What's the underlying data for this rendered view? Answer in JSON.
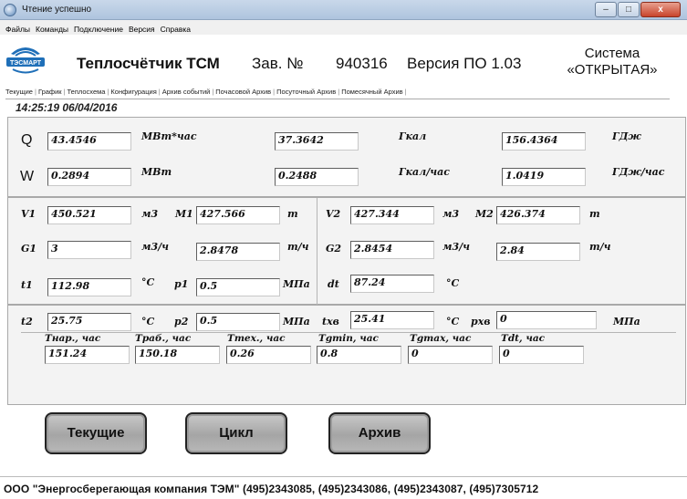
{
  "window": {
    "title": "Чтение успешно",
    "btn_min": "–",
    "btn_max": "□",
    "btn_close": "x"
  },
  "menu": [
    "Файлы",
    "Команды",
    "Подключение",
    "Версия",
    "Справка"
  ],
  "logo_text": "ТЭСМАРТ",
  "header": {
    "title": "Теплосчётчик ТСМ",
    "serial_label": "Зав. №",
    "serial": "940316",
    "version": "Версия ПО 1.03",
    "system_line1": "Система",
    "system_line2": "«ОТКРЫТАЯ»"
  },
  "tabs": [
    "Текущие",
    "График",
    "Теплосхема",
    "Конфигурация",
    "Архив событий",
    "Почасовой Архив",
    "Посуточный Архив",
    "Помесячный Архив"
  ],
  "timestamp": "14:25:19 06/04/2016",
  "energy": {
    "q_label": "Q",
    "q_mwh": "43.4546",
    "q_mwh_unit": "МВт*час",
    "q_gcal": "37.3642",
    "q_gcal_unit": "Гкал",
    "q_gj": "156.4364",
    "q_gj_unit": "ГДж",
    "w_label": "W",
    "w_mw": "0.2894",
    "w_mw_unit": "МВт",
    "w_gcalh": "0.2488",
    "w_gcalh_unit": "Гкал/час",
    "w_gjh": "1.0419",
    "w_gjh_unit": "ГДж/час"
  },
  "ch1": {
    "v1_label": "V1",
    "v1": "450.521",
    "v1_unit": "м3",
    "m1_label": "M1",
    "m1": "427.566",
    "m1_unit": "т",
    "g1_label": "G1",
    "g1": "3",
    "g1_unit": "м3/ч",
    "g1m": "2.8478",
    "g1m_unit": "т/ч",
    "t1_label": "t1",
    "t1": "112.98",
    "t1_unit": "°C",
    "p1_label": "p1",
    "p1": "0.5",
    "p1_unit": "МПа"
  },
  "ch2": {
    "v2_label": "V2",
    "v2": "427.344",
    "v2_unit": "м3",
    "m2_label": "M2",
    "m2": "426.374",
    "m2_unit": "т",
    "g2_label": "G2",
    "g2": "2.8454",
    "g2_unit": "м3/ч",
    "g2m": "2.84",
    "g2m_unit": "т/ч",
    "dt_label": "dt",
    "dt": "87.24",
    "dt_unit": "°C"
  },
  "ret": {
    "t2_label": "t2",
    "t2": "25.75",
    "t2_unit": "°C",
    "p2_label": "p2",
    "p2": "0.5",
    "p2_unit": "МПа",
    "txb_label": "txв",
    "txb": "25.41",
    "txb_unit": "°C",
    "pxb_label": "pxв",
    "pxb": "0",
    "pxb_unit": "МПа"
  },
  "times": {
    "tnar_label": "Tнар., час",
    "tnar": "151.24",
    "trab_label": "Tраб., час",
    "trab": "150.18",
    "ttex_label": "Tтех., час",
    "ttex": "0.26",
    "tgmin_label": "Tgmin, час",
    "tgmin": "0.8",
    "tgmax_label": "Tgmax, час",
    "tgmax": "0",
    "tdt_label": "Tdt, час",
    "tdt": "0"
  },
  "buttons": {
    "current": "Текущие",
    "cycle": "Цикл",
    "archive": "Архив"
  },
  "footer": "ООО \"Энергосберегающая компания ТЭМ\"  (495)2343085, (495)2343086, (495)2343087, (495)7305712"
}
